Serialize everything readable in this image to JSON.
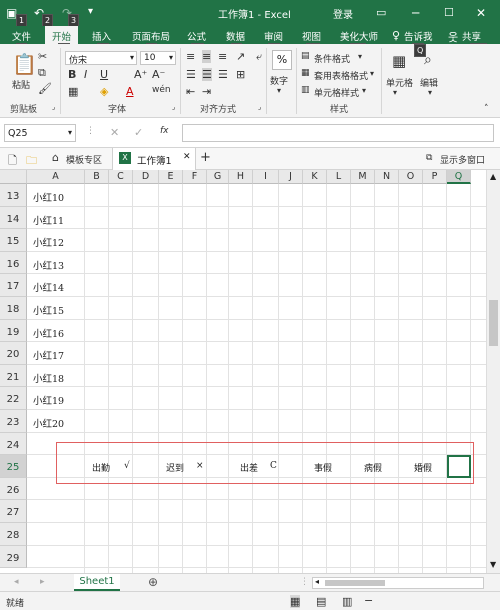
{
  "titlebar": {
    "title": "工作簿1 - Excel",
    "signin": "登录",
    "keytips": [
      "1",
      "2",
      "3"
    ]
  },
  "tabs": [
    {
      "label": "文件",
      "key": "F"
    },
    {
      "label": "开始",
      "key": "H"
    },
    {
      "label": "插入",
      "key": "N"
    },
    {
      "label": "页面布局",
      "key": "P"
    },
    {
      "label": "公式",
      "key": "M"
    },
    {
      "label": "数据",
      "key": "A"
    },
    {
      "label": "审阅",
      "key": "R"
    },
    {
      "label": "视图",
      "key": "W"
    },
    {
      "label": "美化大师",
      "key": "Y1"
    },
    {
      "label": "告诉我",
      "key": "Q"
    },
    {
      "label": "共享",
      "key": "YU"
    }
  ],
  "ribbon": {
    "paste": "粘贴",
    "clipboard": "剪贴板",
    "font_name": "仿宋",
    "font_size": "10",
    "font": "字体",
    "alignment": "对齐方式",
    "number": "数字",
    "number_symbol": "%",
    "cond_format": "条件格式",
    "table_format": "套用表格格式",
    "cell_style": "单元格样式",
    "styles": "样式",
    "cells": "单元格",
    "editing": "编辑"
  },
  "formula": {
    "namebox": "Q25",
    "fx": "fx",
    "value": ""
  },
  "doc_tabs": {
    "template": "模板专区",
    "workbook": "工作簿1",
    "add": "+",
    "multi_window": "显示多窗口"
  },
  "columns": [
    "A",
    "B",
    "C",
    "D",
    "E",
    "F",
    "G",
    "H",
    "I",
    "J",
    "K",
    "L",
    "M",
    "N",
    "O",
    "P",
    "Q"
  ],
  "rows": [
    {
      "num": "13",
      "a": "小红10"
    },
    {
      "num": "14",
      "a": "小红11"
    },
    {
      "num": "15",
      "a": "小红12"
    },
    {
      "num": "16",
      "a": "小红13"
    },
    {
      "num": "17",
      "a": "小红14"
    },
    {
      "num": "18",
      "a": "小红15"
    },
    {
      "num": "19",
      "a": "小红16"
    },
    {
      "num": "20",
      "a": "小红17"
    },
    {
      "num": "21",
      "a": "小红18"
    },
    {
      "num": "22",
      "a": "小红19"
    },
    {
      "num": "23",
      "a": "小红20"
    },
    {
      "num": "24",
      "a": ""
    },
    {
      "num": "25",
      "a": ""
    },
    {
      "num": "26",
      "a": ""
    },
    {
      "num": "27",
      "a": ""
    },
    {
      "num": "28",
      "a": ""
    },
    {
      "num": "29",
      "a": ""
    }
  ],
  "legend": {
    "chuqin": "出勤",
    "check": "√",
    "chidao": "迟到",
    "cross": "×",
    "chuchai": "出差",
    "c": "C",
    "shijia": "事假",
    "bingjia": "病假",
    "hunjia": "婚假"
  },
  "sheet": {
    "name": "Sheet1",
    "add": "⊕"
  },
  "status": {
    "text": "就绪"
  },
  "colors": {
    "accent": "#217346",
    "highlight_box": "#e06060"
  }
}
